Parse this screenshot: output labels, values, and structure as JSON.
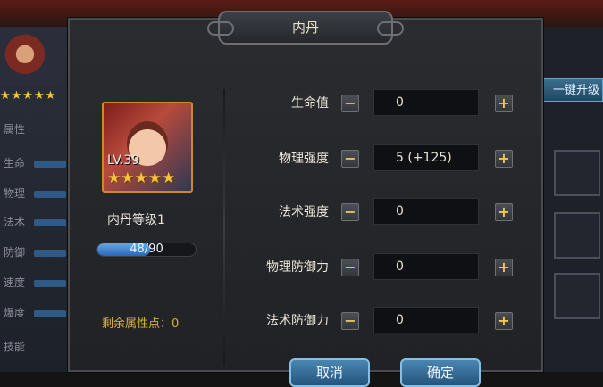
{
  "background": {
    "stars": "★★★★★",
    "left_labels": [
      "属性",
      "生命",
      "物理",
      "法术",
      "防御",
      "速度",
      "爆度",
      "技能"
    ],
    "upgrade_button": "一键升级"
  },
  "dialog": {
    "title": "内丹",
    "portrait": {
      "level_text": "LV.39",
      "stars": "★★★★★"
    },
    "level_label": "内丹等级1",
    "xp": {
      "current": 48,
      "max": 90,
      "text": "48/90",
      "fraction": 0.533
    },
    "remaining_label": "剩余属性点：0",
    "stats": [
      {
        "label": "生命值",
        "value": "0"
      },
      {
        "label": "物理强度",
        "value": "5 (+125)"
      },
      {
        "label": "法术强度",
        "value": "0"
      },
      {
        "label": "物理防御力",
        "value": "0"
      },
      {
        "label": "法术防御力",
        "value": "0"
      }
    ],
    "minus_symbol": "−",
    "plus_symbol": "+",
    "cancel_label": "取消",
    "confirm_label": "确定"
  },
  "colors": {
    "accent_gold": "#f6c33b",
    "button_blue": "#2c66b6",
    "remaining_text": "#d9b13a"
  }
}
